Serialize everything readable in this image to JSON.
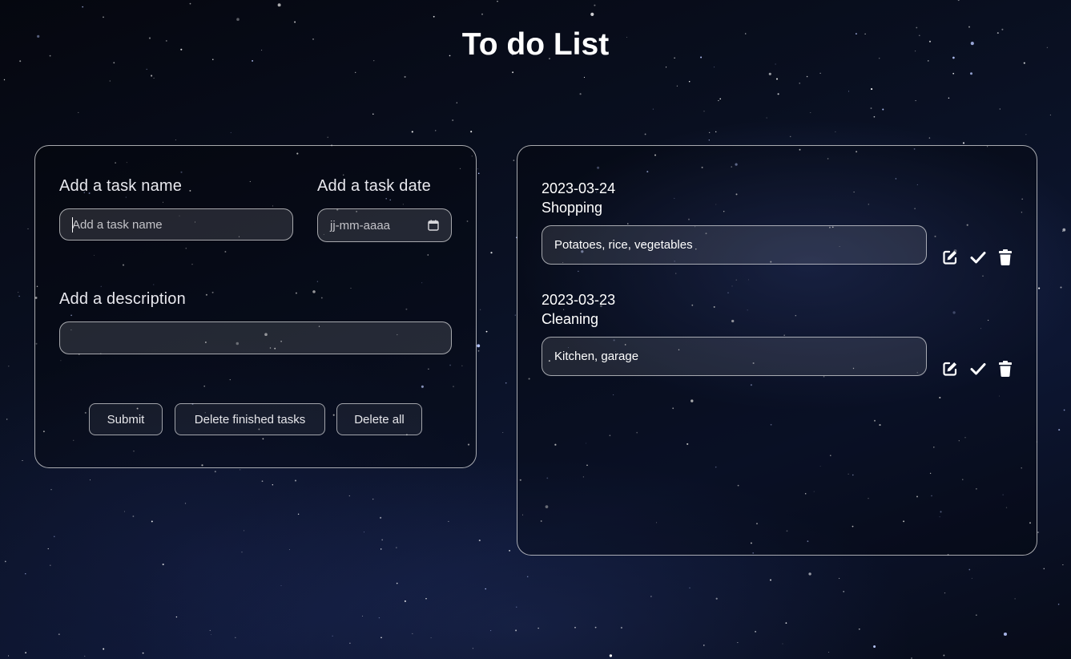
{
  "header": {
    "title": "To do List"
  },
  "form": {
    "task_name_label": "Add a task name",
    "task_name_placeholder": "Add a task name",
    "task_date_label": "Add a task date",
    "task_date_placeholder": "jj-mm-aaaa",
    "description_label": "Add a description",
    "description_value": "",
    "buttons": {
      "submit": "Submit",
      "delete_finished": "Delete finished tasks",
      "delete_all": "Delete all"
    }
  },
  "tasks": [
    {
      "date": "2023-03-24",
      "name": "Shopping",
      "description": "Potatoes, rice, vegetables"
    },
    {
      "date": "2023-03-23",
      "name": "Cleaning",
      "description": "Kitchen, garage"
    }
  ],
  "icons": {
    "edit": "edit-icon",
    "done": "check-icon",
    "delete": "trash-icon",
    "calendar": "calendar-icon"
  },
  "colors": {
    "background": "#0a1124",
    "text": "#ffffff",
    "border": "#c8c8d0"
  }
}
